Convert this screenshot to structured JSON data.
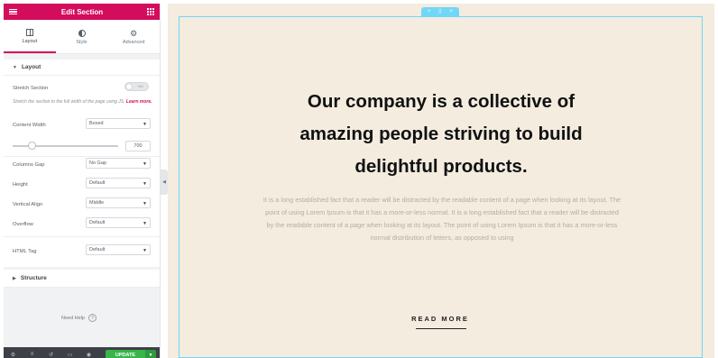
{
  "panel": {
    "title": "Edit Section",
    "tabs": [
      {
        "label": "Layout",
        "icon": "layout-icon",
        "active": true
      },
      {
        "label": "Style",
        "icon": "style-icon",
        "active": false
      },
      {
        "label": "Advanced",
        "icon": "gear-icon",
        "active": false
      }
    ],
    "layout_section": {
      "title": "Layout",
      "stretch_label": "Stretch Section",
      "stretch_toggle": "NO",
      "stretch_desc": "Stretch the section to the full width of the page using JS.",
      "learn_more": "Learn more.",
      "content_width_label": "Content Width",
      "content_width_value": "Boxed",
      "width_value": "700",
      "columns_gap_label": "Columns Gap",
      "columns_gap_value": "No Gap",
      "height_label": "Height",
      "height_value": "Default",
      "valign_label": "Vertical Align",
      "valign_value": "Middle",
      "overflow_label": "Overflow",
      "overflow_value": "Default",
      "html_tag_label": "HTML Tag",
      "html_tag_value": "Default"
    },
    "structure_title": "Structure",
    "need_help": "Need Help",
    "update_label": "UPDATE"
  },
  "canvas": {
    "headline": "Our company is a collective of amazing people striving to build delightful products.",
    "paragraph": "It is a long established fact that a reader will be distracted by the readable content of a page when looking at its layout. The point of using Lorem Ipsum is that it has a more-or-less normal. It is a long established fact that a reader will be distracted by the readable content of a page when looking at its layout. The point of using Lorem Ipsum is that it has a more-or-less normal distribution of letters, as opposed to using",
    "read_more": "READ MORE"
  },
  "colors": {
    "brand": "#d30c5c",
    "update": "#39b54a",
    "selection": "#71d7f7",
    "canvas_bg": "#f3ecdf"
  }
}
